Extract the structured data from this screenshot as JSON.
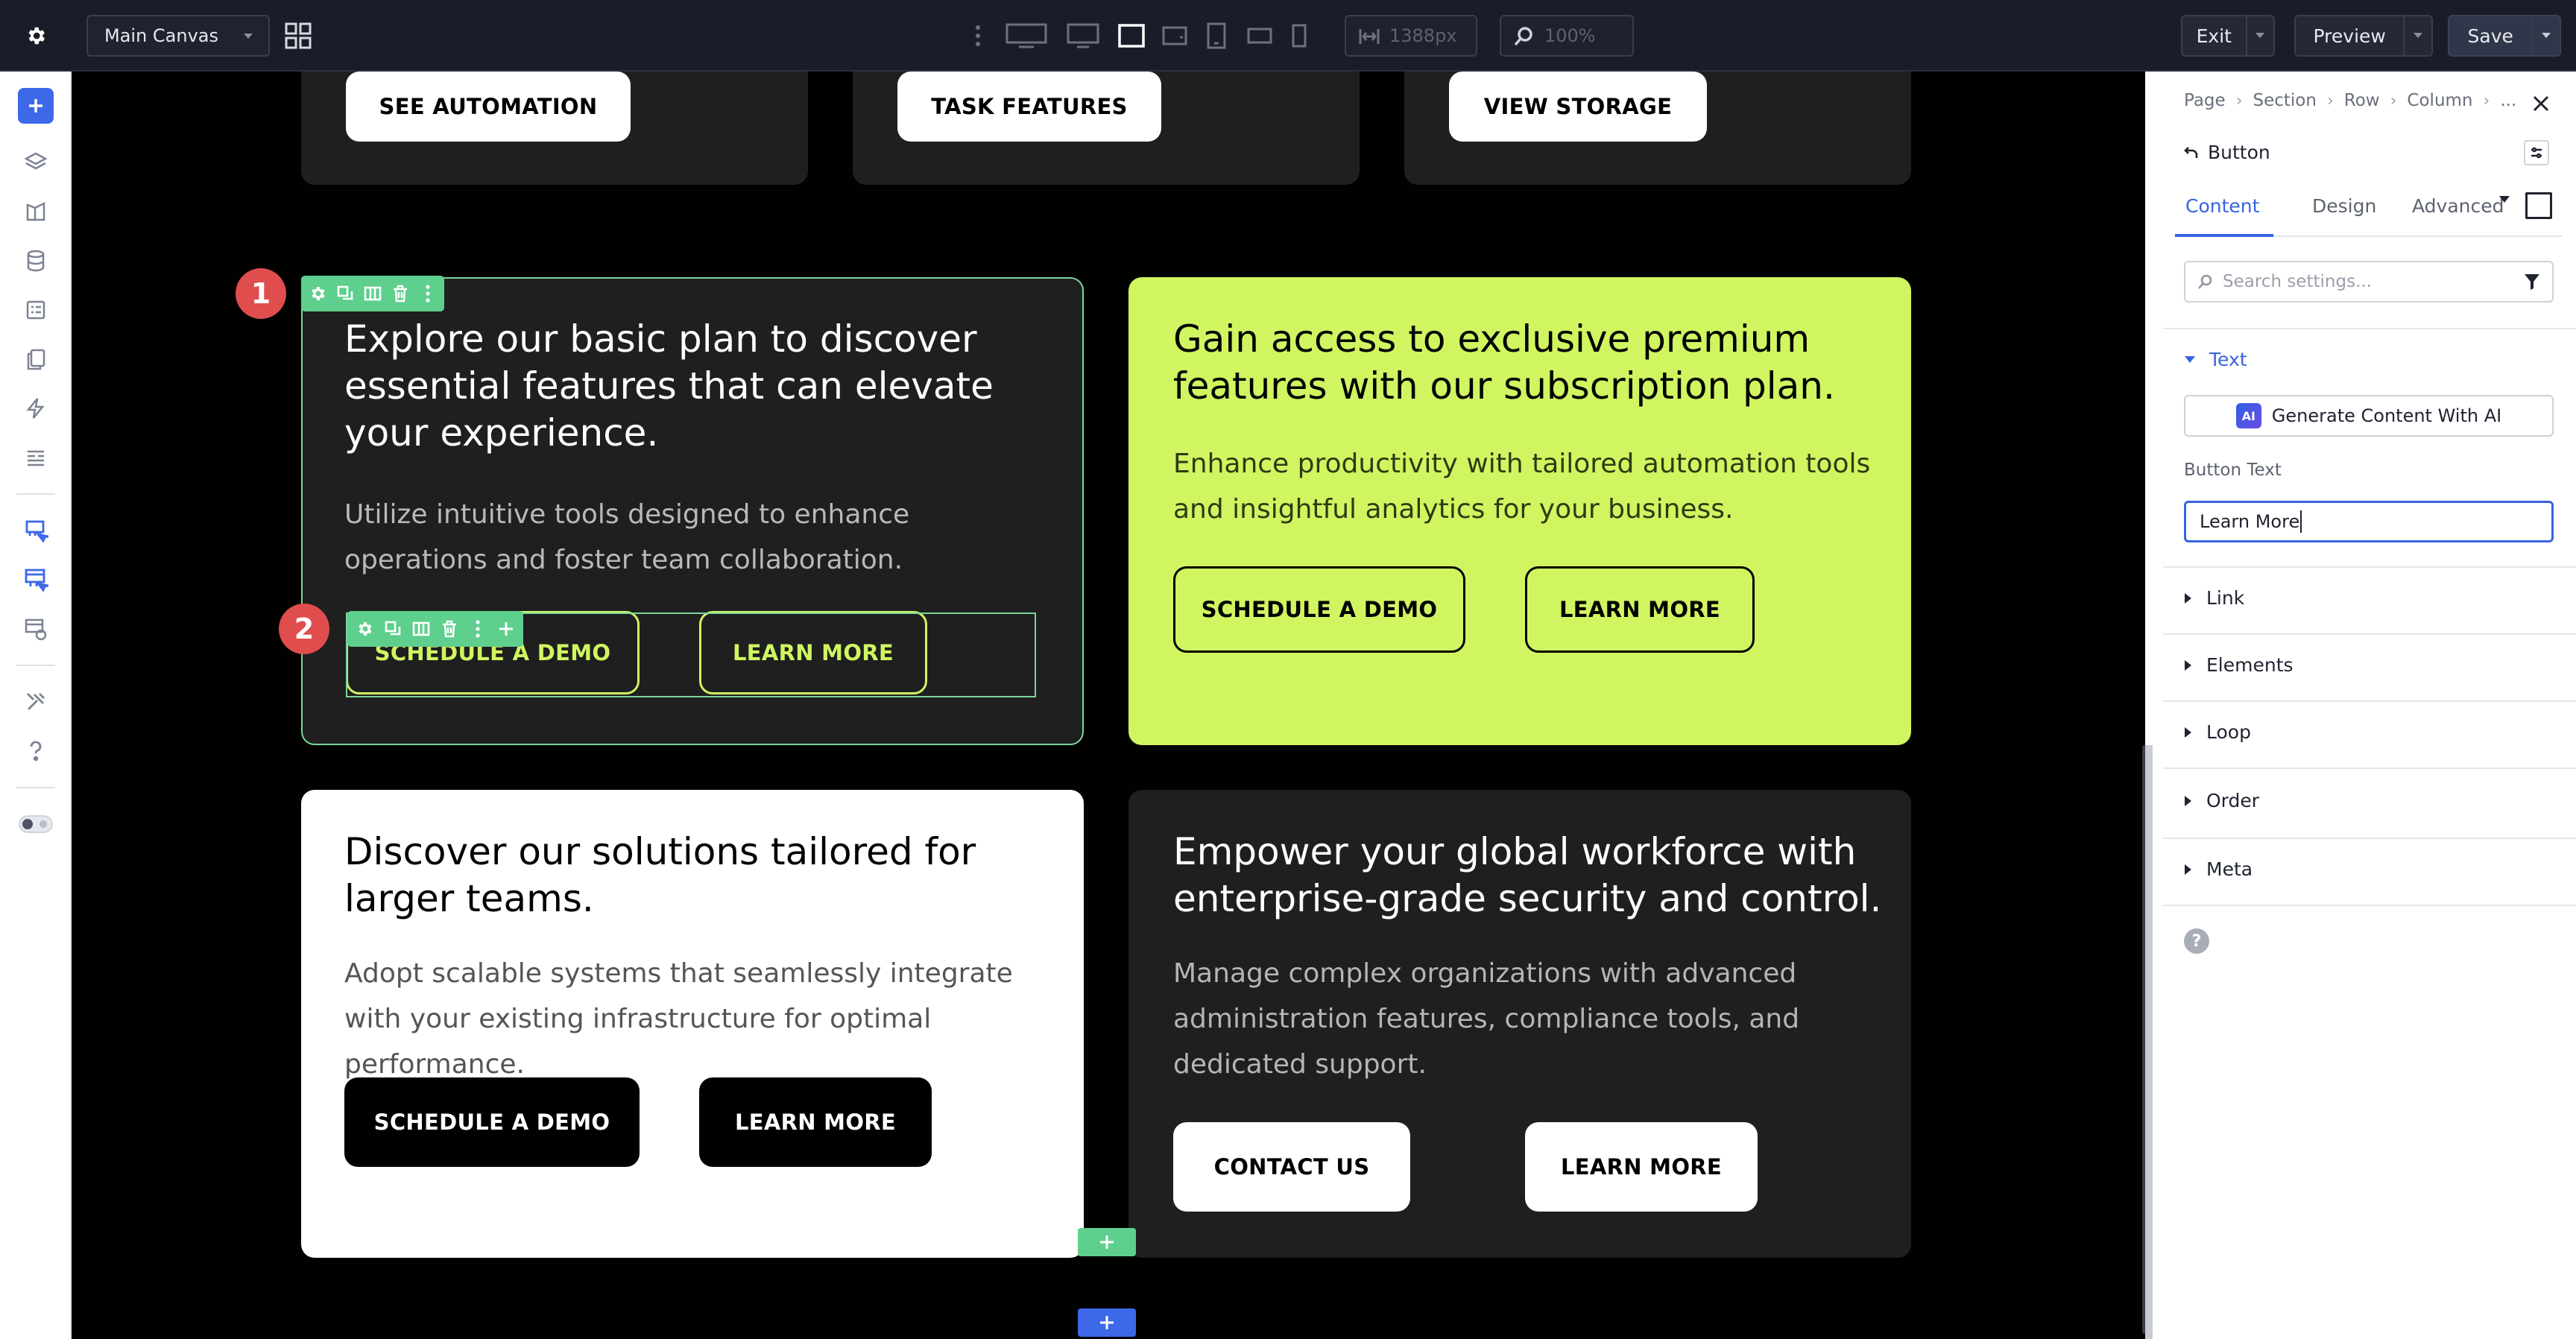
{
  "topbar": {
    "canvas_select": "Main Canvas",
    "width_value": "1388px",
    "zoom_value": "100%",
    "exit_label": "Exit",
    "preview_label": "Preview",
    "save_label": "Save"
  },
  "canvas": {
    "top_cards": [
      {
        "button": "SEE AUTOMATION"
      },
      {
        "button": "TASK FEATURES"
      },
      {
        "button": "VIEW STORAGE"
      }
    ],
    "cards": [
      {
        "heading": "Explore our basic plan to discover essential features that can elevate your experience.",
        "text": "Utilize intuitive tools designed to enhance operations and foster team collaboration.",
        "btn1": "SCHEDULE A DEMO",
        "btn2": "LEARN MORE"
      },
      {
        "heading": "Gain access to exclusive premium features with our subscription plan.",
        "text": "Enhance productivity with tailored automation tools and insightful analytics for your business.",
        "btn1": "SCHEDULE A DEMO",
        "btn2": "LEARN MORE"
      },
      {
        "heading": "Discover our solutions tailored for larger teams.",
        "text": "Adopt scalable systems that seamlessly integrate with your existing infrastructure for optimal performance.",
        "btn1": "SCHEDULE A DEMO",
        "btn2": "LEARN MORE"
      },
      {
        "heading": "Empower your global workforce with enterprise-grade security and control.",
        "text": "Manage complex organizations with advanced administration features, compliance tools, and dedicated support.",
        "btn1": "CONTACT US",
        "btn2": "LEARN MORE"
      }
    ],
    "badges": [
      "1",
      "2"
    ]
  },
  "panel": {
    "breadcrumb": [
      "Page",
      "Section",
      "Row",
      "Column",
      "..."
    ],
    "element_title": "Button",
    "tabs": [
      "Content",
      "Design",
      "Advanced"
    ],
    "search_placeholder": "Search settings...",
    "sections": {
      "text": "Text",
      "link": "Link",
      "elements": "Elements",
      "loop": "Loop",
      "order": "Order",
      "meta": "Meta"
    },
    "ai_icon_text": "AI",
    "ai_button": "Generate Content With AI",
    "button_text_label": "Button Text",
    "button_text_value": "Learn More",
    "help_icon_text": "?"
  },
  "colors": {
    "accent_blue": "#3864df",
    "lime": "#d0f561",
    "selection_green": "#5ecf8d",
    "badge_red": "#e04d4d",
    "topbar_bg": "#1a1d29"
  }
}
